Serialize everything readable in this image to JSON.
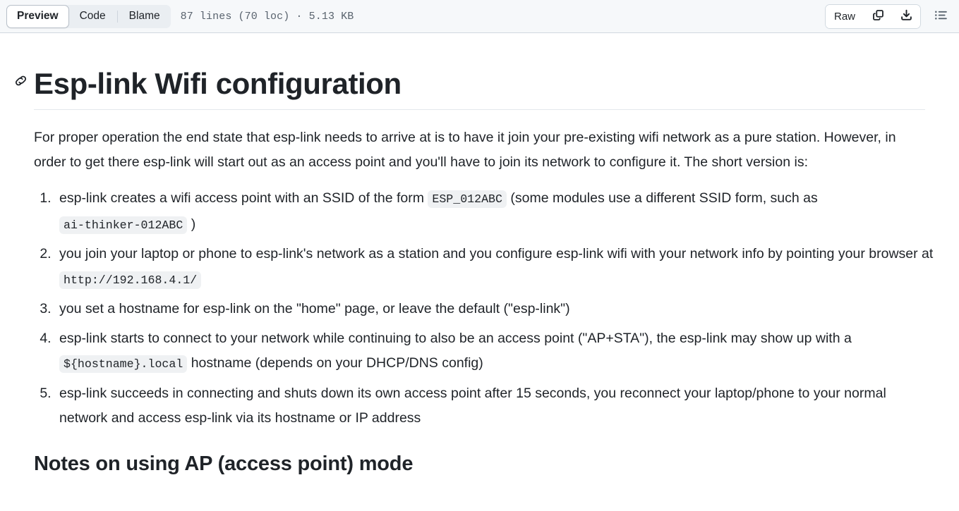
{
  "header": {
    "tabs": [
      {
        "label": "Preview",
        "selected": true
      },
      {
        "label": "Code",
        "selected": false
      },
      {
        "label": "Blame",
        "selected": false
      }
    ],
    "file_meta": "87 lines (70 loc) · 5.13 KB",
    "raw_label": "Raw",
    "copy_icon": "copy-icon",
    "download_icon": "download-icon",
    "outline_icon": "outline-list-icon",
    "background": "#f6f8fa",
    "border_color": "#d1d9e0"
  },
  "document": {
    "anchor_icon": "link-icon",
    "title": "Esp-link Wifi configuration",
    "intro": "For proper operation the end state that esp-link needs to arrive at is to have it join your pre-existing wifi network as a pure station. However, in order to get there esp-link will start out as an access point and you'll have to join its network to configure it. The short version is:",
    "steps": [
      {
        "parts": [
          {
            "type": "text",
            "value": "esp-link creates a wifi access point with an SSID of the form "
          },
          {
            "type": "code",
            "value": "ESP_012ABC"
          },
          {
            "type": "text",
            "value": " (some modules use a different SSID form, such as "
          },
          {
            "type": "code",
            "value": "ai-thinker-012ABC"
          },
          {
            "type": "text",
            "value": " )"
          }
        ]
      },
      {
        "parts": [
          {
            "type": "text",
            "value": "you join your laptop or phone to esp-link's network as a station and you configure esp-link wifi with your network info by pointing your browser at "
          },
          {
            "type": "code",
            "value": "http://192.168.4.1/"
          }
        ]
      },
      {
        "parts": [
          {
            "type": "text",
            "value": "you set a hostname for esp-link on the \"home\" page, or leave the default (\"esp-link\")"
          }
        ]
      },
      {
        "parts": [
          {
            "type": "text",
            "value": "esp-link starts to connect to your network while continuing to also be an access point (\"AP+STA\"), the esp-link may show up with a "
          },
          {
            "type": "code",
            "value": "${hostname}.local"
          },
          {
            "type": "text",
            "value": " hostname (depends on your DHCP/DNS config)"
          }
        ]
      },
      {
        "parts": [
          {
            "type": "text",
            "value": "esp-link succeeds in connecting and shuts down its own access point after 15 seconds, you reconnect your laptop/phone to your normal network and access esp-link via its hostname or IP address"
          }
        ]
      }
    ],
    "section_heading": "Notes on using AP (access point) mode",
    "text_color": "#1f2328",
    "code_bg": "#eff1f3"
  }
}
